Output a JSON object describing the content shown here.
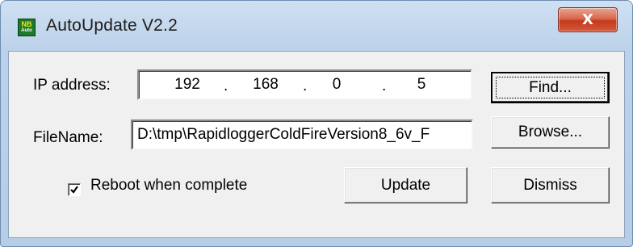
{
  "window": {
    "title": "AutoUpdate V2.2",
    "icon": {
      "name": "nb-auto-app-icon",
      "text_top": "NB",
      "text_bottom": "Auto"
    },
    "close_icon": "close-icon",
    "close_glyph": "X"
  },
  "form": {
    "ip_label": "IP address:",
    "ip_octets": [
      "192",
      "168",
      "0",
      "5"
    ],
    "ip_separator": ".",
    "filename_label": "FileName:",
    "filename_value": "D:\\tmp\\RapidloggerColdFireVersion8_6v_F",
    "reboot_label": "Reboot when complete",
    "reboot_checked": true
  },
  "buttons": {
    "find": "Find...",
    "browse": "Browse...",
    "update": "Update",
    "dismiss": "Dismiss"
  },
  "colors": {
    "frame": "#bcd2ea",
    "close_button": "#c5391d",
    "dialog_background": "#f0f0f0"
  }
}
